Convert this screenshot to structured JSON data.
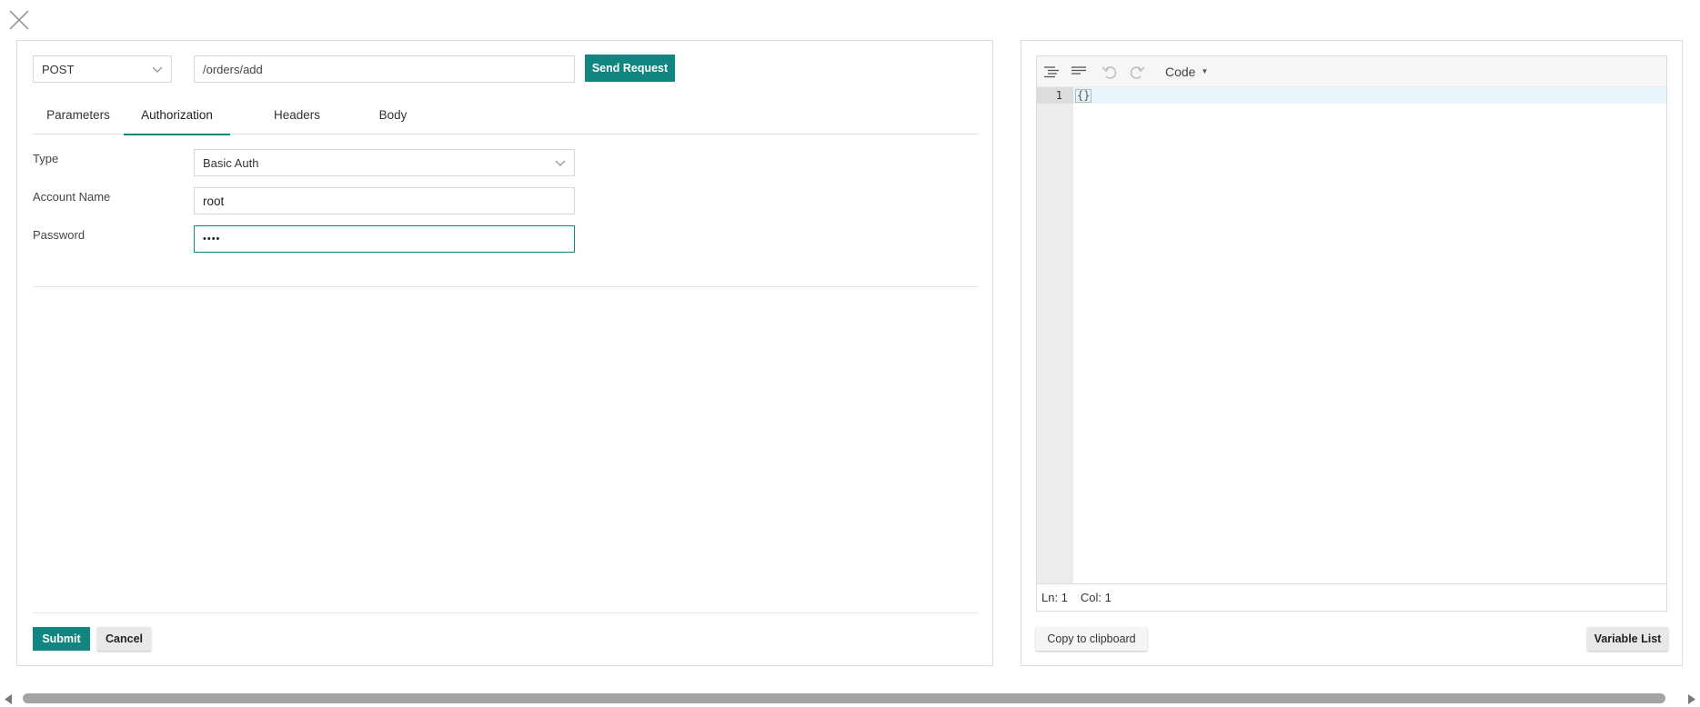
{
  "request": {
    "method": "POST",
    "url": "/orders/add",
    "send_label": "Send Request"
  },
  "tabs": [
    {
      "label": "Parameters",
      "active": false
    },
    {
      "label": "Authorization",
      "active": true
    },
    {
      "label": "Headers",
      "active": false
    },
    {
      "label": "Body",
      "active": false
    }
  ],
  "auth": {
    "type_label": "Type",
    "type_value": "Basic Auth",
    "account_label": "Account Name",
    "account_value": "root",
    "password_label": "Password",
    "password_value": "••••"
  },
  "actions": {
    "submit_label": "Submit",
    "cancel_label": "Cancel"
  },
  "editor": {
    "mode": "Code",
    "line_numbers": [
      "1"
    ],
    "content": "{}",
    "status_ln": "Ln: 1",
    "status_col": "Col: 1",
    "copy_label": "Copy to clipboard",
    "varlist_label": "Variable List"
  },
  "icons": {
    "close": "close-icon",
    "format": "format-icon",
    "compact": "compact-icon",
    "undo": "undo-icon",
    "redo": "redo-icon"
  },
  "colors": {
    "accent": "#11857f",
    "editor_highlight": "#e6f4fb"
  }
}
